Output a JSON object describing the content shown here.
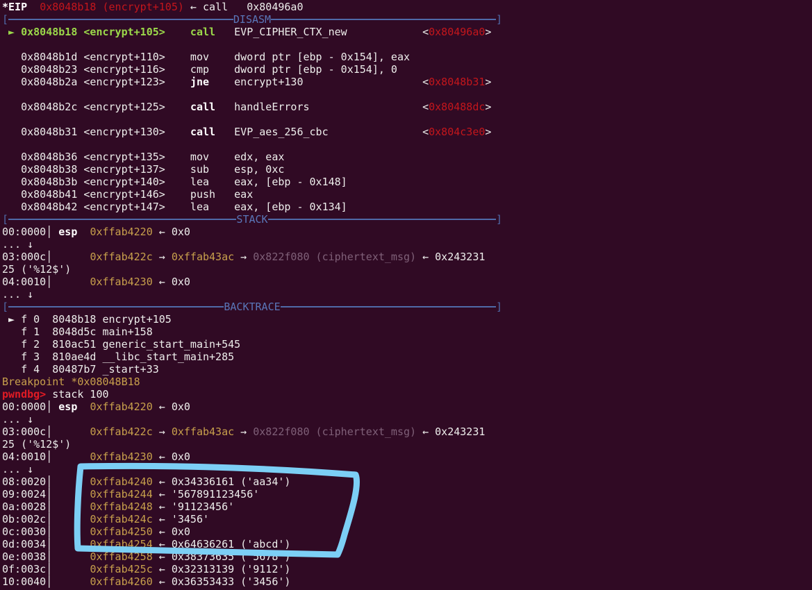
{
  "terminal": {
    "lines": [
      {
        "segs": [
          {
            "t": "*EIP",
            "c": "wb"
          },
          {
            "t": "  ",
            "c": "w"
          },
          {
            "t": "0x8048b18 (encrypt+105)",
            "c": "r"
          },
          {
            "t": " ← call   0x80496a0",
            "c": "w"
          }
        ]
      },
      {
        "section": "DISASM"
      },
      {
        "segs": [
          {
            "t": " ► ",
            "c": "g"
          },
          {
            "t": "0x8048b18 <encrypt+105>    call",
            "c": "g"
          },
          {
            "t": "   EVP_CIPHER_CTX_new            <",
            "c": "w"
          },
          {
            "t": "0x80496a0",
            "c": "r"
          },
          {
            "t": ">",
            "c": "w"
          }
        ]
      },
      {
        "segs": []
      },
      {
        "segs": [
          {
            "t": "   0x8048b1d <encrypt+110>    mov    dword ptr [ebp - 0x154], eax",
            "c": "w"
          }
        ]
      },
      {
        "segs": [
          {
            "t": "   0x8048b23 <encrypt+116>    cmp    dword ptr [ebp - 0x154], 0",
            "c": "w"
          }
        ]
      },
      {
        "segs": [
          {
            "t": "   0x8048b2a <encrypt+123>    ",
            "c": "w"
          },
          {
            "t": "jne",
            "c": "wb"
          },
          {
            "t": "    encrypt+130                   <",
            "c": "w"
          },
          {
            "t": "0x8048b31",
            "c": "r"
          },
          {
            "t": ">",
            "c": "w"
          }
        ]
      },
      {
        "segs": []
      },
      {
        "segs": [
          {
            "t": "   0x8048b2c <encrypt+125>    ",
            "c": "w"
          },
          {
            "t": "call",
            "c": "wb"
          },
          {
            "t": "   handleErrors                  <",
            "c": "w"
          },
          {
            "t": "0x80488dc",
            "c": "r"
          },
          {
            "t": ">",
            "c": "w"
          }
        ]
      },
      {
        "segs": []
      },
      {
        "segs": [
          {
            "t": "   0x8048b31 <encrypt+130>    ",
            "c": "w"
          },
          {
            "t": "call",
            "c": "wb"
          },
          {
            "t": "   EVP_aes_256_cbc               <",
            "c": "w"
          },
          {
            "t": "0x804c3e0",
            "c": "r"
          },
          {
            "t": ">",
            "c": "w"
          }
        ]
      },
      {
        "segs": []
      },
      {
        "segs": [
          {
            "t": "   0x8048b36 <encrypt+135>    mov    edx, eax",
            "c": "w"
          }
        ]
      },
      {
        "segs": [
          {
            "t": "   0x8048b38 <encrypt+137>    sub    esp, 0xc",
            "c": "w"
          }
        ]
      },
      {
        "segs": [
          {
            "t": "   0x8048b3b <encrypt+140>    lea    eax, [ebp - 0x148]",
            "c": "w"
          }
        ]
      },
      {
        "segs": [
          {
            "t": "   0x8048b41 <encrypt+146>    push   eax",
            "c": "w"
          }
        ]
      },
      {
        "segs": [
          {
            "t": "   0x8048b42 <encrypt+147>    lea    eax, [ebp - 0x134]",
            "c": "w"
          }
        ]
      },
      {
        "section": "STACK"
      },
      {
        "segs": [
          {
            "t": "00:0000│ ",
            "c": "w"
          },
          {
            "t": "esp",
            "c": "wb"
          },
          {
            "t": "  ",
            "c": "w"
          },
          {
            "t": "0xffab4220",
            "c": "y"
          },
          {
            "t": " ← 0x0",
            "c": "w"
          }
        ]
      },
      {
        "segs": [
          {
            "t": "... ↓",
            "c": "w"
          }
        ]
      },
      {
        "segs": [
          {
            "t": "03:000c│      ",
            "c": "w"
          },
          {
            "t": "0xffab422c",
            "c": "y"
          },
          {
            "t": " → ",
            "c": "w"
          },
          {
            "t": "0xffab43ac",
            "c": "y"
          },
          {
            "t": " → ",
            "c": "w"
          },
          {
            "t": "0x822f080 (ciphertext_msg)",
            "c": "gr"
          },
          {
            "t": " ← 0x243231",
            "c": "w"
          }
        ]
      },
      {
        "segs": [
          {
            "t": "25 ('%12$')",
            "c": "w"
          }
        ]
      },
      {
        "segs": [
          {
            "t": "04:0010│      ",
            "c": "w"
          },
          {
            "t": "0xffab4230",
            "c": "y"
          },
          {
            "t": " ← 0x0",
            "c": "w"
          }
        ]
      },
      {
        "segs": [
          {
            "t": "... ↓",
            "c": "w"
          }
        ]
      },
      {
        "section": "BACKTRACE"
      },
      {
        "segs": [
          {
            "t": " ► f 0  8048b18 encrypt+105",
            "c": "w"
          }
        ]
      },
      {
        "segs": [
          {
            "t": "   f 1  8048d5c main+158",
            "c": "w"
          }
        ]
      },
      {
        "segs": [
          {
            "t": "   f 2  810ac51 generic_start_main+545",
            "c": "w"
          }
        ]
      },
      {
        "segs": [
          {
            "t": "   f 3  810ae4d __libc_start_main+285",
            "c": "w"
          }
        ]
      },
      {
        "segs": [
          {
            "t": "   f 4  80487b7 _start+33",
            "c": "w"
          }
        ]
      },
      {
        "segs": [
          {
            "t": "Breakpoint *0x08048B18",
            "c": "y"
          }
        ]
      },
      {
        "segs": [
          {
            "t": "pwndbg>",
            "c": "rb"
          },
          {
            "t": " stack 100",
            "c": "w"
          }
        ]
      },
      {
        "segs": [
          {
            "t": "00:0000│ ",
            "c": "w"
          },
          {
            "t": "esp",
            "c": "wb"
          },
          {
            "t": "  ",
            "c": "w"
          },
          {
            "t": "0xffab4220",
            "c": "y"
          },
          {
            "t": " ← 0x0",
            "c": "w"
          }
        ]
      },
      {
        "segs": [
          {
            "t": "... ↓",
            "c": "w"
          }
        ]
      },
      {
        "segs": [
          {
            "t": "03:000c│      ",
            "c": "w"
          },
          {
            "t": "0xffab422c",
            "c": "y"
          },
          {
            "t": " → ",
            "c": "w"
          },
          {
            "t": "0xffab43ac",
            "c": "y"
          },
          {
            "t": " → ",
            "c": "w"
          },
          {
            "t": "0x822f080 (ciphertext_msg)",
            "c": "gr"
          },
          {
            "t": " ← 0x243231",
            "c": "w"
          }
        ]
      },
      {
        "segs": [
          {
            "t": "25 ('%12$')",
            "c": "w"
          }
        ]
      },
      {
        "segs": [
          {
            "t": "04:0010│      ",
            "c": "w"
          },
          {
            "t": "0xffab4230",
            "c": "y"
          },
          {
            "t": " ← 0x0",
            "c": "w"
          }
        ]
      },
      {
        "segs": [
          {
            "t": "... ↓",
            "c": "w"
          }
        ]
      },
      {
        "segs": [
          {
            "t": "08:0020│      ",
            "c": "w"
          },
          {
            "t": "0xffab4240",
            "c": "y"
          },
          {
            "t": " ← 0x34336161 ('aa34')",
            "c": "w"
          }
        ]
      },
      {
        "segs": [
          {
            "t": "09:0024│      ",
            "c": "w"
          },
          {
            "t": "0xffab4244",
            "c": "y"
          },
          {
            "t": " ← '567891123456'",
            "c": "w"
          }
        ]
      },
      {
        "segs": [
          {
            "t": "0a:0028│      ",
            "c": "w"
          },
          {
            "t": "0xffab4248",
            "c": "y"
          },
          {
            "t": " ← '91123456'",
            "c": "w"
          }
        ]
      },
      {
        "segs": [
          {
            "t": "0b:002c│      ",
            "c": "w"
          },
          {
            "t": "0xffab424c",
            "c": "y"
          },
          {
            "t": " ← '3456'",
            "c": "w"
          }
        ]
      },
      {
        "segs": [
          {
            "t": "0c:0030│      ",
            "c": "w"
          },
          {
            "t": "0xffab4250",
            "c": "y"
          },
          {
            "t": " ← 0x0",
            "c": "w"
          }
        ]
      },
      {
        "segs": [
          {
            "t": "0d:0034│      ",
            "c": "w"
          },
          {
            "t": "0xffab4254",
            "c": "y"
          },
          {
            "t": " ← 0x64636261 ('abcd')",
            "c": "w"
          }
        ]
      },
      {
        "segs": [
          {
            "t": "0e:0038│      ",
            "c": "w"
          },
          {
            "t": "0xffab4258",
            "c": "y"
          },
          {
            "t": " ← 0x38373635 ('5678')",
            "c": "w"
          }
        ]
      },
      {
        "segs": [
          {
            "t": "0f:003c│      ",
            "c": "w"
          },
          {
            "t": "0xffab425c",
            "c": "y"
          },
          {
            "t": " ← 0x32313139 ('9112')",
            "c": "w"
          }
        ]
      },
      {
        "segs": [
          {
            "t": "10:0040│      ",
            "c": "w"
          },
          {
            "t": "0xffab4260",
            "c": "y"
          },
          {
            "t": " ← 0x36353433 ('3456')",
            "c": "w"
          }
        ]
      }
    ]
  },
  "colors": {
    "background": "#300a24",
    "highlight_annotation": "#7ccff5"
  }
}
